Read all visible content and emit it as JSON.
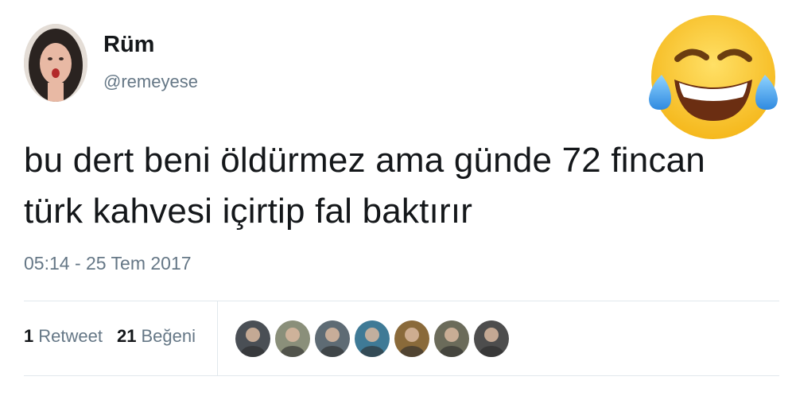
{
  "tweet": {
    "author_name": "Rüm",
    "author_handle": "@remeyese",
    "text_line1": "bu dert beni öldürmez ama günde 72 fincan",
    "text_line2": "türk kahvesi içirtip fal baktırır",
    "timestamp": "05:14 - 25 Tem 2017"
  },
  "stats": {
    "retweets_count": "1",
    "retweets_label": "Retweet",
    "likes_count": "21",
    "likes_label": "Beğeni"
  },
  "likers": [
    {
      "icon": "avatar-icon",
      "color": "#4a4f55"
    },
    {
      "icon": "avatar-icon",
      "color": "#8a8f7a"
    },
    {
      "icon": "avatar-icon",
      "color": "#5e6b74"
    },
    {
      "icon": "avatar-icon",
      "color": "#3f7a96"
    },
    {
      "icon": "avatar-icon",
      "color": "#8a6a3a"
    },
    {
      "icon": "avatar-icon",
      "color": "#6b6b5a"
    },
    {
      "icon": "avatar-icon",
      "color": "#4d4d4d"
    }
  ],
  "overlay": {
    "icon": "tears-of-joy-emoji-icon"
  },
  "colors": {
    "primary_text": "#14171a",
    "secondary_text": "#657786",
    "divider": "#e1e8ed"
  }
}
